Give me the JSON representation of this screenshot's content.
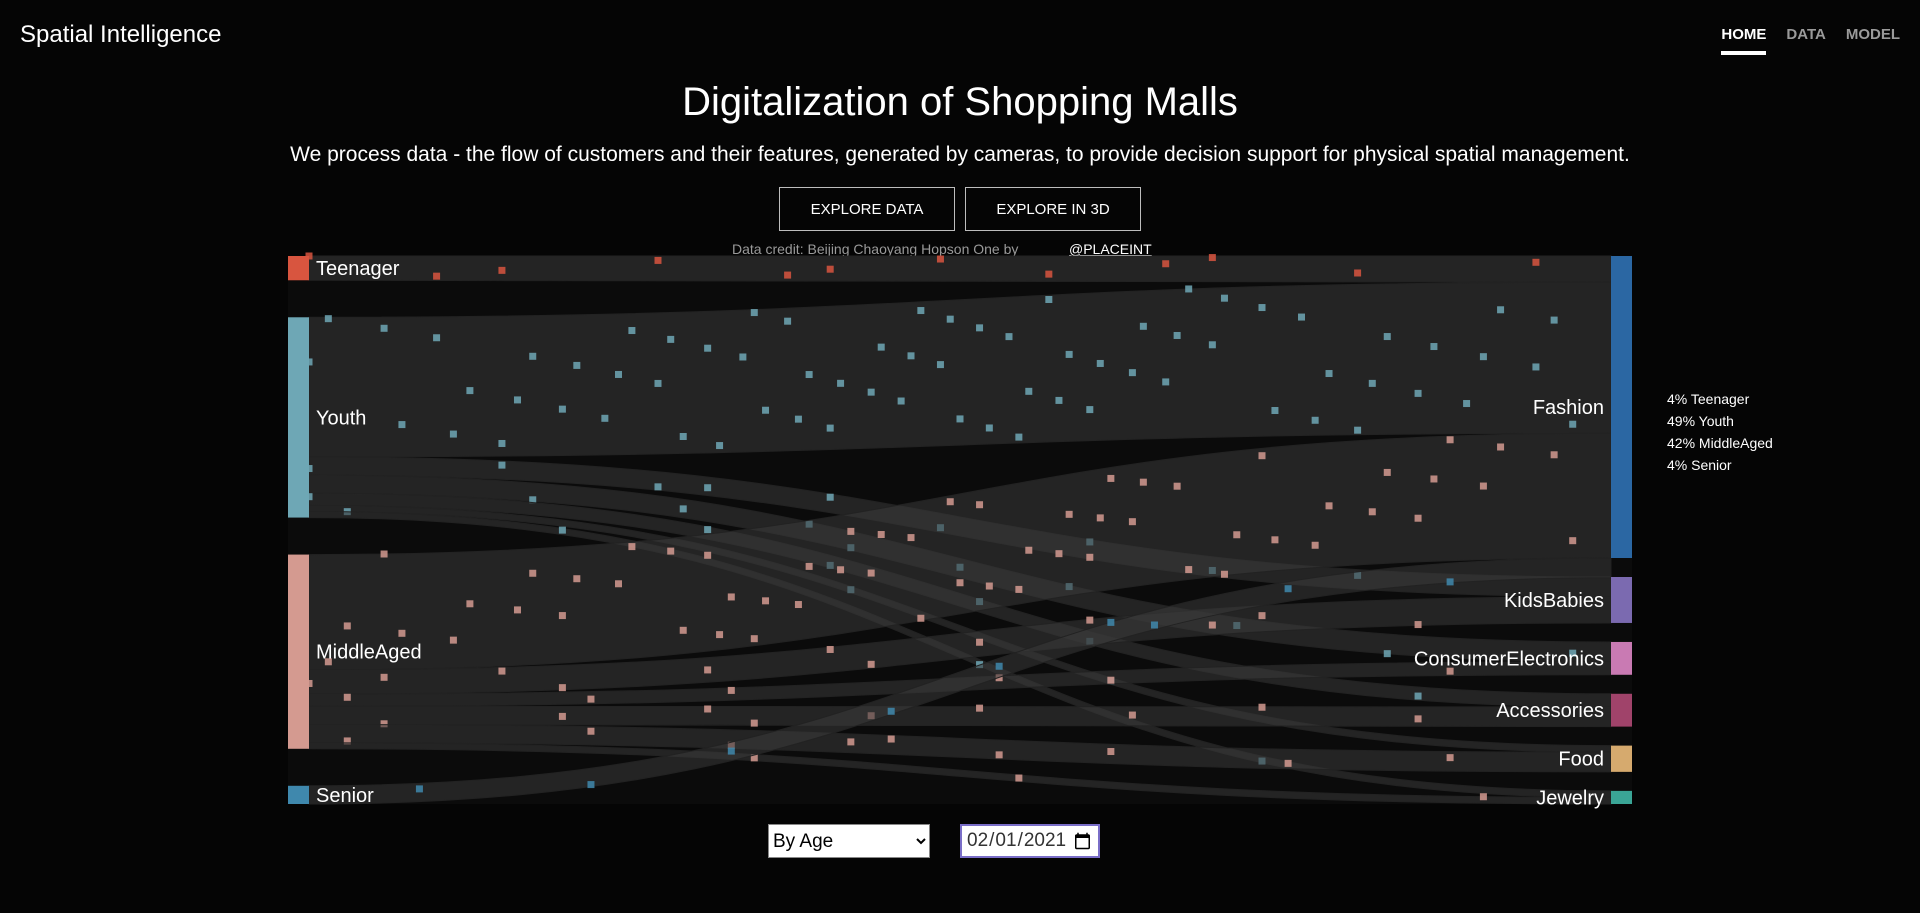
{
  "header": {
    "brand": "Spatial Intelligence",
    "nav": [
      {
        "label": "HOME",
        "active": true
      },
      {
        "label": "DATA",
        "active": false
      },
      {
        "label": "MODEL",
        "active": false
      }
    ]
  },
  "hero": {
    "title": "Digitalization of Shopping Malls",
    "subtitle": "We process data - the flow of customers and their features, generated by cameras, to provide decision support for physical spatial management.",
    "explore_data_label": "EXPLORE DATA",
    "explore_3d_label": "EXPLORE IN 3D",
    "credit_text": "Data credit: Beijing Chaoyang Hopson One by",
    "credit_link": "@PLACEINT"
  },
  "sankey": {
    "colors": {
      "Teenager": "#d8553f",
      "Youth": "#6ea7b5",
      "MiddleAged": "#d49a90",
      "Senior": "#3f88ad",
      "Fashion": "#2b67a3",
      "KidsBabies": "#7b6ab0",
      "ConsumerElectronics": "#c97ab3",
      "Accessories": "#a0436a",
      "Food": "#d6aa6e",
      "Jewelry": "#3aa596"
    },
    "sources": [
      {
        "name": "Teenager",
        "value": 4
      },
      {
        "name": "Youth",
        "value": 33
      },
      {
        "name": "MiddleAged",
        "value": 32
      },
      {
        "name": "Senior",
        "value": 3
      }
    ],
    "targets": [
      {
        "name": "Fashion",
        "value": 46
      },
      {
        "name": "KidsBabies",
        "value": 7
      },
      {
        "name": "ConsumerElectronics",
        "value": 5
      },
      {
        "name": "Accessories",
        "value": 5
      },
      {
        "name": "Food",
        "value": 4
      },
      {
        "name": "Jewelry",
        "value": 2
      }
    ],
    "links": [
      {
        "source": "Teenager",
        "target": "Fashion",
        "value": 4
      },
      {
        "source": "Youth",
        "target": "Fashion",
        "value": 23
      },
      {
        "source": "Youth",
        "target": "KidsBabies",
        "value": 3
      },
      {
        "source": "Youth",
        "target": "ConsumerElectronics",
        "value": 3
      },
      {
        "source": "Youth",
        "target": "Accessories",
        "value": 2
      },
      {
        "source": "Youth",
        "target": "Food",
        "value": 1
      },
      {
        "source": "Youth",
        "target": "Jewelry",
        "value": 1
      },
      {
        "source": "MiddleAged",
        "target": "Fashion",
        "value": 19
      },
      {
        "source": "MiddleAged",
        "target": "KidsBabies",
        "value": 4
      },
      {
        "source": "MiddleAged",
        "target": "ConsumerElectronics",
        "value": 2
      },
      {
        "source": "MiddleAged",
        "target": "Accessories",
        "value": 3
      },
      {
        "source": "MiddleAged",
        "target": "Food",
        "value": 3
      },
      {
        "source": "MiddleAged",
        "target": "Jewelry",
        "value": 1
      },
      {
        "source": "Senior",
        "target": "Fashion",
        "value": 3
      }
    ],
    "legend": [
      "4% Teenager",
      "49% Youth",
      "42% MiddleAged",
      "4% Senior"
    ]
  },
  "controls": {
    "group_by_options": [
      "By Age"
    ],
    "group_by_selected": "By Age",
    "date_value": "2021-02-01"
  }
}
